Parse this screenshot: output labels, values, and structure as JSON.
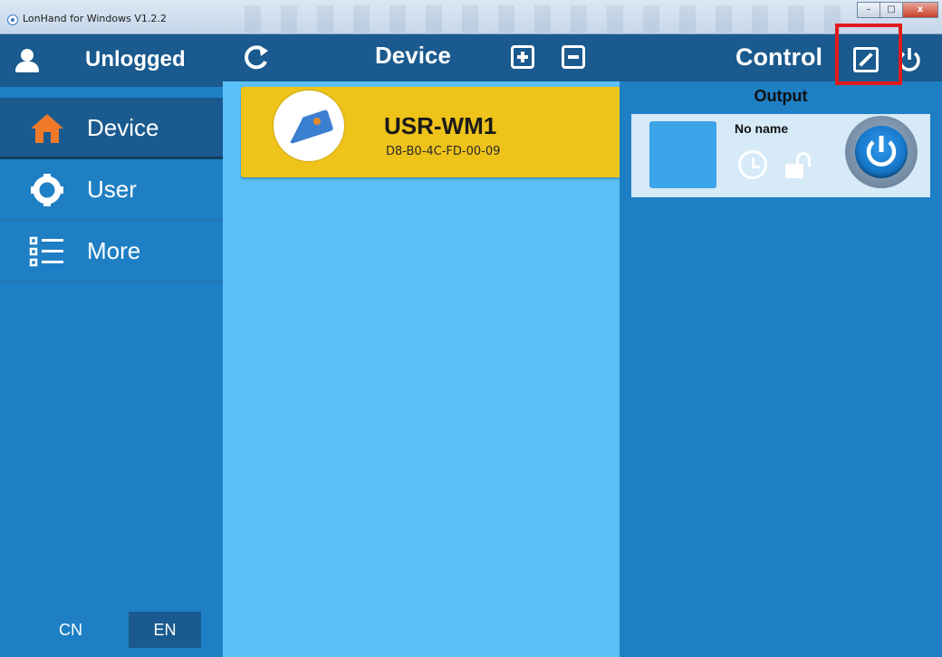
{
  "window": {
    "title": "LonHand for Windows V1.2.2",
    "buttons": {
      "minimize": "–",
      "maximize": "□",
      "close": "x"
    }
  },
  "sidebar": {
    "user": "Unlogged",
    "items": [
      {
        "label": "Device",
        "icon": "home-icon",
        "active": true
      },
      {
        "label": "User",
        "icon": "gear-icon",
        "active": false
      },
      {
        "label": "More",
        "icon": "list-icon",
        "active": false
      }
    ],
    "languages": {
      "cn": "CN",
      "en": "EN",
      "selected": "EN"
    }
  },
  "device_panel": {
    "title": "Device",
    "devices": [
      {
        "name": "USR-WM1",
        "mac": "D8-B0-4C-FD-00-09",
        "selected": true
      }
    ]
  },
  "control_panel": {
    "title": "Control",
    "section": "Output",
    "outputs": [
      {
        "name": "No name",
        "state": "on"
      }
    ]
  },
  "colors": {
    "sidebar_bg": "#1e7fc4",
    "header_bg": "#1a5a8e",
    "device_bg": "#5bc0f8",
    "selected_card": "#eec31a",
    "accent_home": "#f07a2a",
    "highlight": "#e01b1b"
  }
}
